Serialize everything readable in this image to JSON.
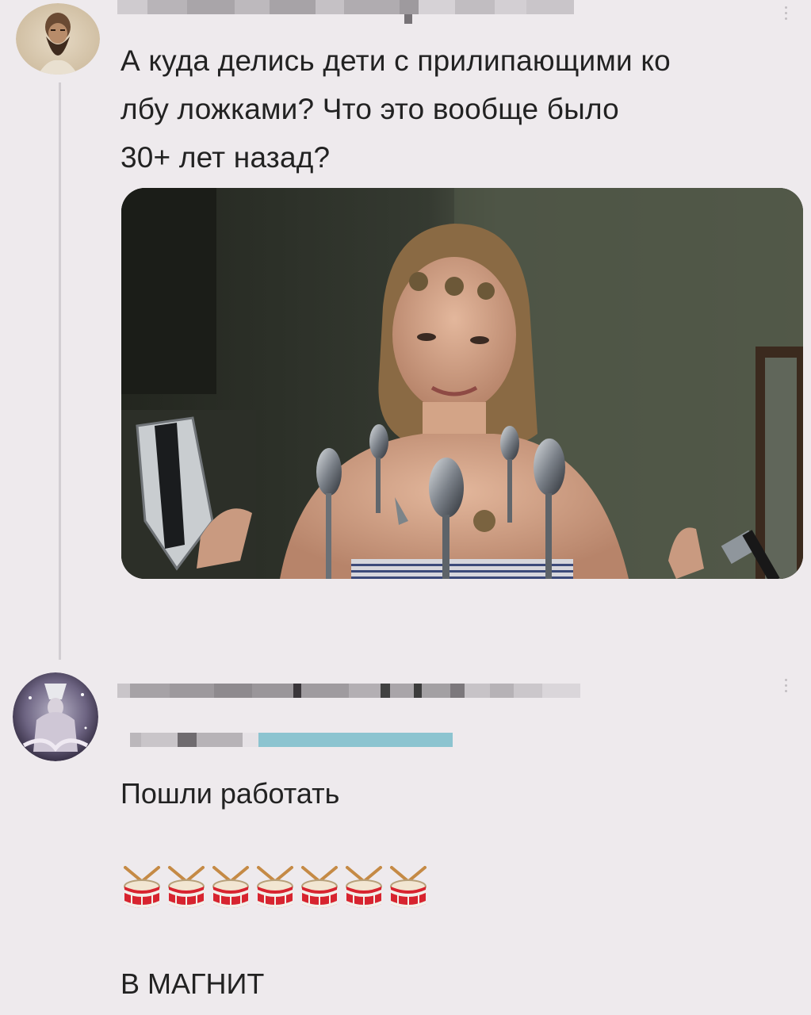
{
  "post": {
    "text": "А куда делись дети с прилипающими ко лбу ложками? Что это вообще было 30+ лет назад?",
    "line1": "А куда делись дети с прилипающими ко",
    "line2": "лбу ложками? Что это вообще было",
    "line3": "30+ лет назад?",
    "menu_icon": "more-vertical-icon"
  },
  "reply": {
    "line1": "Пошли работать",
    "emoji": "🥁🥁🥁🥁🥁🥁🥁",
    "emoji_count": 7,
    "line3": "В МАГНИТ",
    "menu_icon": "more-vertical-icon"
  },
  "colors": {
    "background": "#eeeaed",
    "text": "#222222",
    "thread_line": "#d2ced2",
    "link_censored": "#8cc4d0"
  }
}
